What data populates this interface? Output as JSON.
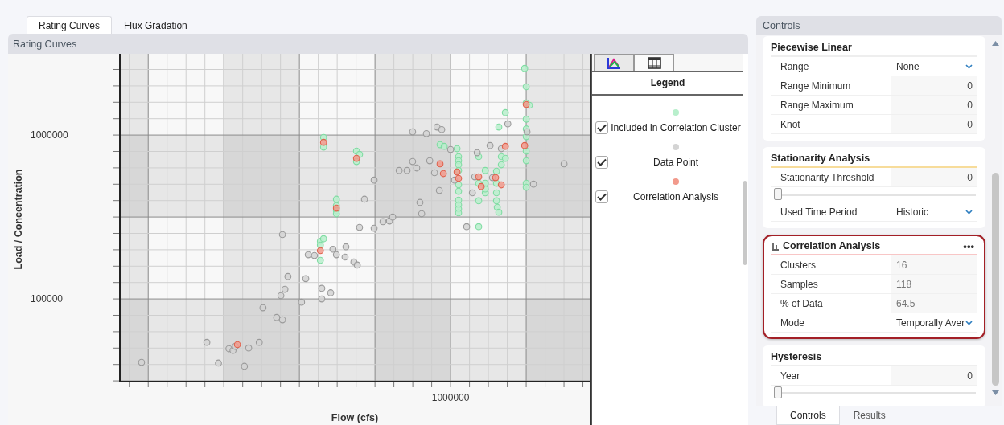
{
  "tabs": [
    {
      "label": "Rating Curves",
      "selected": true
    },
    {
      "label": "Flux Gradation",
      "selected": false
    }
  ],
  "panel_title": "Rating Curves",
  "chart": {
    "kind": "scatter",
    "xlabel": "Flow (cfs)",
    "ylabel": "Load / Concentration",
    "y_tick_labels": [
      "1000000",
      "100000"
    ],
    "x_tick_labels": [
      "1000000"
    ]
  },
  "legend": {
    "title": "Legend",
    "items": [
      {
        "label": "Included in Correlation Cluster",
        "color": "#b8efcc",
        "checked": true
      },
      {
        "label": "Data Point",
        "color": "#d4d4d4",
        "checked": true
      },
      {
        "label": "Correlation Analysis",
        "color": "#f29a8c",
        "checked": true
      }
    ]
  },
  "controls": {
    "title": "Controls",
    "sections": [
      {
        "title": "Piecewise Linear",
        "color": "#eeeeee",
        "highlighted": false,
        "rows": [
          {
            "kind": "dropdown",
            "label": "Range",
            "value": "None"
          },
          {
            "kind": "number",
            "label": "Range Minimum",
            "value": "0"
          },
          {
            "kind": "number",
            "label": "Range Maximum",
            "value": "0"
          },
          {
            "kind": "number",
            "label": "Knot",
            "value": "0"
          }
        ]
      },
      {
        "title": "Stationarity Analysis",
        "color": "#f7dc9a",
        "highlighted": false,
        "rows": [
          {
            "kind": "number",
            "label": "Stationarity Threshold",
            "value": "0"
          },
          {
            "kind": "slider",
            "level": 0
          },
          {
            "kind": "dropdown",
            "label": "Used Time Period",
            "value": "Historic"
          }
        ]
      },
      {
        "title": "Correlation Analysis",
        "color": "#f8c6c6",
        "highlighted": true,
        "menu": "•••",
        "rows": [
          {
            "kind": "readout",
            "label": "Clusters",
            "value": "16"
          },
          {
            "kind": "readout",
            "label": "Samples",
            "value": "118"
          },
          {
            "kind": "readout",
            "label": "% of Data",
            "value": "64.5"
          },
          {
            "kind": "dropdown",
            "label": "Mode",
            "value": "Temporally Aver"
          }
        ]
      },
      {
        "title": "Hysteresis",
        "color": "#eeeeee",
        "highlighted": false,
        "rows": [
          {
            "kind": "number",
            "label": "Year",
            "value": "0"
          },
          {
            "kind": "slider",
            "level": 0
          }
        ]
      }
    ],
    "tabs": [
      {
        "label": "Controls",
        "selected": true
      },
      {
        "label": "Results",
        "selected": false
      }
    ]
  }
}
